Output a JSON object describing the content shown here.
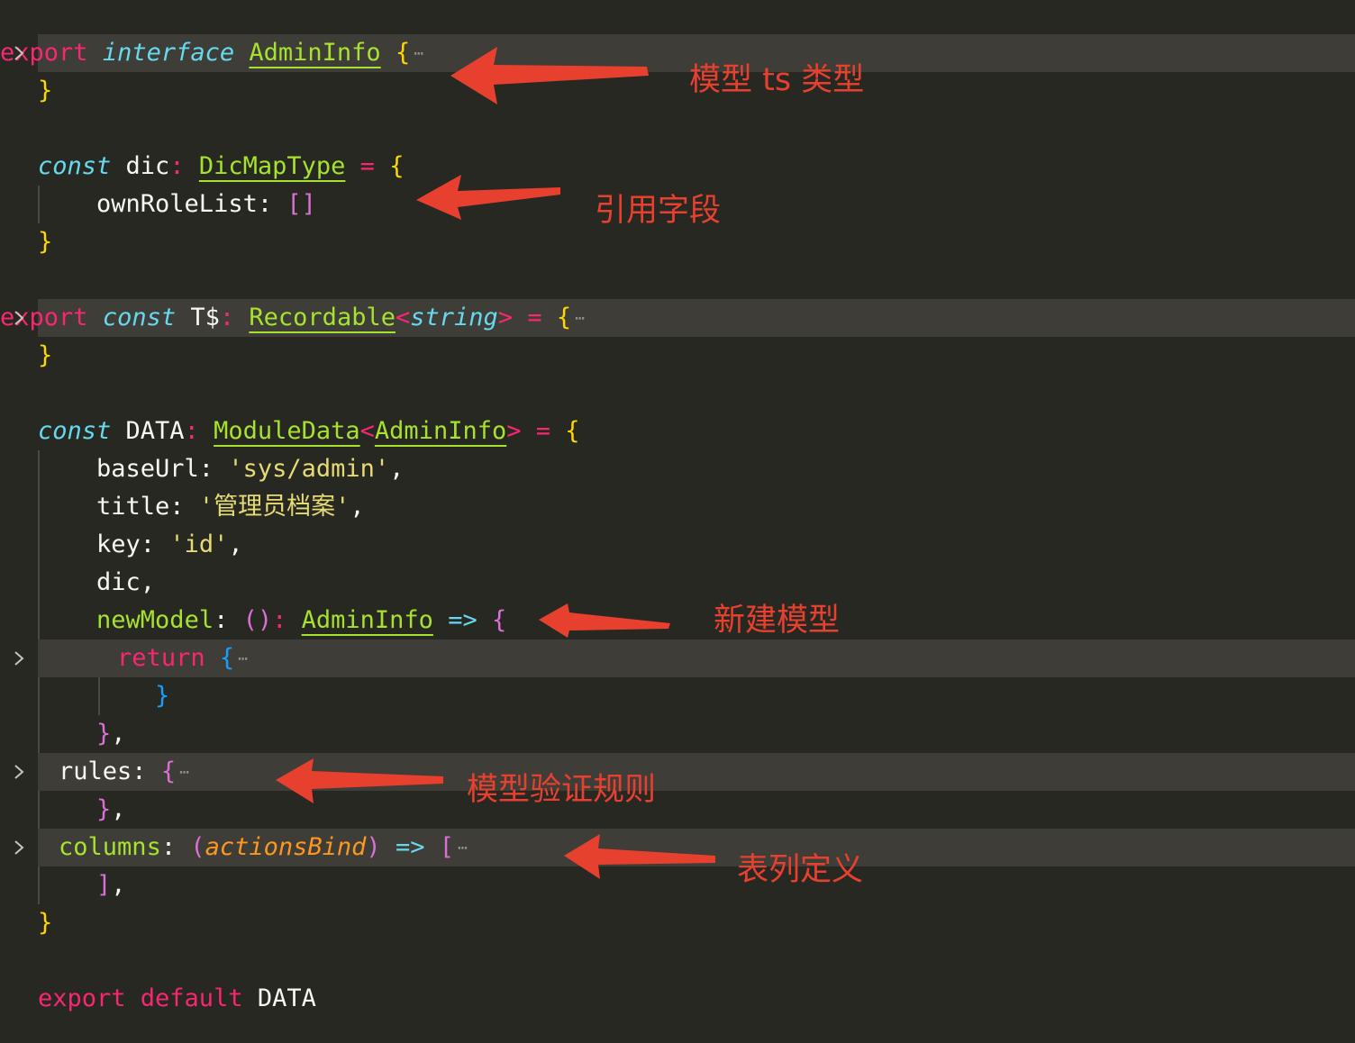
{
  "editor": {
    "lines": [
      {
        "tokens": [
          {
            "t": "export",
            "c": "kw"
          },
          {
            "t": " "
          },
          {
            "t": "interface",
            "c": "st"
          },
          {
            "t": " "
          },
          {
            "t": "AdminInfo",
            "c": "ty"
          },
          {
            "t": " "
          },
          {
            "t": "{",
            "c": "br1"
          }
        ],
        "folded": true
      },
      {
        "tokens": [
          {
            "t": "}",
            "c": "br1"
          }
        ]
      },
      {
        "tokens": []
      },
      {
        "tokens": [
          {
            "t": "const",
            "c": "st"
          },
          {
            "t": " dic"
          },
          {
            "t": ":",
            "c": "op"
          },
          {
            "t": " "
          },
          {
            "t": "DicMapType",
            "c": "ty"
          },
          {
            "t": " "
          },
          {
            "t": "=",
            "c": "op"
          },
          {
            "t": " "
          },
          {
            "t": "{",
            "c": "br1"
          }
        ]
      },
      {
        "tokens": [
          {
            "t": "    ownRoleList: "
          },
          {
            "t": "[]",
            "c": "br2"
          }
        ]
      },
      {
        "tokens": [
          {
            "t": "}",
            "c": "br1"
          }
        ]
      },
      {
        "tokens": []
      },
      {
        "tokens": [
          {
            "t": "export",
            "c": "kw"
          },
          {
            "t": " "
          },
          {
            "t": "const",
            "c": "st"
          },
          {
            "t": " T$"
          },
          {
            "t": ":",
            "c": "op"
          },
          {
            "t": " "
          },
          {
            "t": "Recordable",
            "c": "ty"
          },
          {
            "t": "<",
            "c": "op"
          },
          {
            "t": "string",
            "c": "st"
          },
          {
            "t": ">",
            "c": "op"
          },
          {
            "t": " "
          },
          {
            "t": "=",
            "c": "op"
          },
          {
            "t": " "
          },
          {
            "t": "{",
            "c": "br1"
          }
        ],
        "folded": true
      },
      {
        "tokens": [
          {
            "t": "}",
            "c": "br1"
          }
        ]
      },
      {
        "tokens": []
      },
      {
        "tokens": [
          {
            "t": "const",
            "c": "st"
          },
          {
            "t": " DATA"
          },
          {
            "t": ":",
            "c": "op"
          },
          {
            "t": " "
          },
          {
            "t": "ModuleData",
            "c": "ty"
          },
          {
            "t": "<",
            "c": "op"
          },
          {
            "t": "AdminInfo",
            "c": "ty"
          },
          {
            "t": ">",
            "c": "op"
          },
          {
            "t": " "
          },
          {
            "t": "=",
            "c": "op"
          },
          {
            "t": " "
          },
          {
            "t": "{",
            "c": "br1"
          }
        ]
      },
      {
        "tokens": [
          {
            "t": "    baseUrl: "
          },
          {
            "t": "'sys/admin'",
            "c": "str"
          },
          {
            "t": ","
          }
        ]
      },
      {
        "tokens": [
          {
            "t": "    title: "
          },
          {
            "t": "'管理员档案'",
            "c": "str"
          },
          {
            "t": ","
          }
        ]
      },
      {
        "tokens": [
          {
            "t": "    key: "
          },
          {
            "t": "'id'",
            "c": "str"
          },
          {
            "t": ","
          }
        ]
      },
      {
        "tokens": [
          {
            "t": "    dic,"
          }
        ]
      },
      {
        "tokens": [
          {
            "t": "    "
          },
          {
            "t": "newModel",
            "c": "fn"
          },
          {
            "t": ": "
          },
          {
            "t": "()",
            "c": "br2"
          },
          {
            "t": ":",
            "c": "op"
          },
          {
            "t": " "
          },
          {
            "t": "AdminInfo",
            "c": "ty"
          },
          {
            "t": " "
          },
          {
            "t": "=>",
            "c": "arrowop"
          },
          {
            "t": " "
          },
          {
            "t": "{",
            "c": "br2"
          }
        ]
      },
      {
        "tokens": [
          {
            "t": "        "
          },
          {
            "t": "return",
            "c": "kw"
          },
          {
            "t": " "
          },
          {
            "t": "{",
            "c": "br3"
          }
        ],
        "folded": true
      },
      {
        "tokens": [
          {
            "t": "        "
          },
          {
            "t": "}",
            "c": "br3"
          }
        ]
      },
      {
        "tokens": [
          {
            "t": "    "
          },
          {
            "t": "}",
            "c": "br2"
          },
          {
            "t": ","
          }
        ]
      },
      {
        "tokens": [
          {
            "t": "    rules: "
          },
          {
            "t": "{",
            "c": "br2"
          }
        ],
        "folded": true
      },
      {
        "tokens": [
          {
            "t": "    "
          },
          {
            "t": "}",
            "c": "br2"
          },
          {
            "t": ","
          }
        ]
      },
      {
        "tokens": [
          {
            "t": "    "
          },
          {
            "t": "columns",
            "c": "fn"
          },
          {
            "t": ": "
          },
          {
            "t": "(",
            "c": "br2"
          },
          {
            "t": "actionsBind",
            "c": "param"
          },
          {
            "t": ")",
            "c": "br2"
          },
          {
            "t": " "
          },
          {
            "t": "=>",
            "c": "arrowop"
          },
          {
            "t": " "
          },
          {
            "t": "[",
            "c": "br2"
          }
        ],
        "folded": true
      },
      {
        "tokens": [
          {
            "t": "    "
          },
          {
            "t": "]",
            "c": "br2"
          },
          {
            "t": ","
          }
        ]
      },
      {
        "tokens": [
          {
            "t": "}",
            "c": "br1"
          }
        ]
      },
      {
        "tokens": []
      },
      {
        "tokens": [
          {
            "t": "export default",
            "c": "kw"
          },
          {
            "t": " DATA"
          }
        ]
      }
    ],
    "fold_icon": "chevron-right-icon",
    "folded_placeholder": "⋯"
  },
  "annotations": [
    {
      "label": "模型 ts 类型"
    },
    {
      "label": "引用字段"
    },
    {
      "label": "新建模型"
    },
    {
      "label": "模型验证规则"
    },
    {
      "label": "表列定义"
    }
  ],
  "colors": {
    "background": "#272822",
    "keyword": "#f92672",
    "storage": "#66d9ef",
    "type": "#a6e22e",
    "string": "#e6db74",
    "parameter": "#fd971f",
    "annotation": "#e8402f"
  }
}
